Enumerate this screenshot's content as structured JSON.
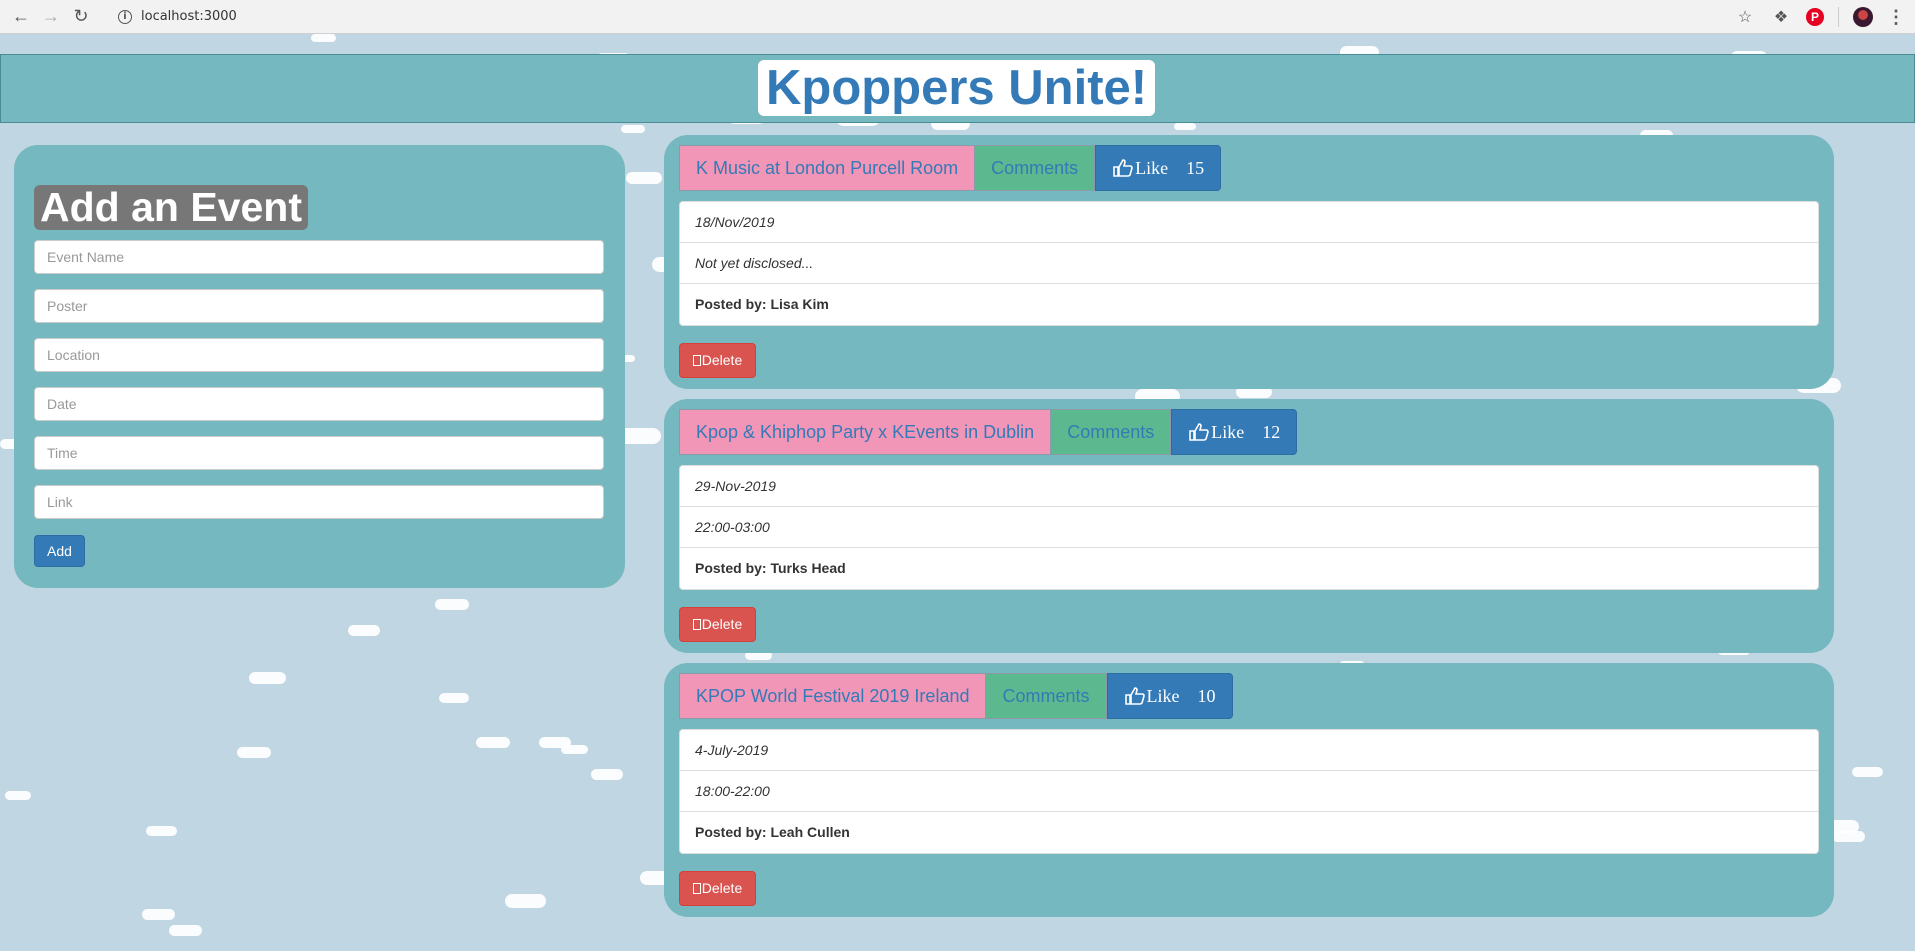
{
  "browser": {
    "url": "localhost:3000"
  },
  "header": {
    "title": "Kpoppers Unite!"
  },
  "add_event": {
    "title": "Add an Event",
    "fields": [
      {
        "placeholder": "Event Name"
      },
      {
        "placeholder": "Poster"
      },
      {
        "placeholder": "Location"
      },
      {
        "placeholder": "Date"
      },
      {
        "placeholder": "Time"
      },
      {
        "placeholder": "Link"
      }
    ],
    "add_label": "Add"
  },
  "events": [
    {
      "name": "K Music at London Purcell Room",
      "comments_label": "Comments",
      "like_label": "Like",
      "likes": "15",
      "date": "18/Nov/2019",
      "time": "Not yet disclosed...",
      "poster_prefix": "Posted by:",
      "poster": "Lisa Kim",
      "delete_label": "Delete"
    },
    {
      "name": "Kpop & Khiphop Party x KEvents in Dublin",
      "comments_label": "Comments",
      "like_label": "Like",
      "likes": "12",
      "date": "29-Nov-2019",
      "time": "22:00-03:00",
      "poster_prefix": "Posted by:",
      "poster": "Turks Head",
      "delete_label": "Delete"
    },
    {
      "name": "KPOP World Festival 2019 Ireland",
      "comments_label": "Comments",
      "like_label": "Like",
      "likes": "10",
      "date": "4-July-2019",
      "time": "18:00-22:00",
      "poster_prefix": "Posted by:",
      "poster": "Leah Cullen",
      "delete_label": "Delete"
    }
  ],
  "colors": {
    "sky": "#c0d6e2",
    "teal": "#75b8bf",
    "title_blue": "#337ab7",
    "pink": "#f296b8",
    "green": "#5cb88f",
    "delete_red": "#d9534f"
  }
}
